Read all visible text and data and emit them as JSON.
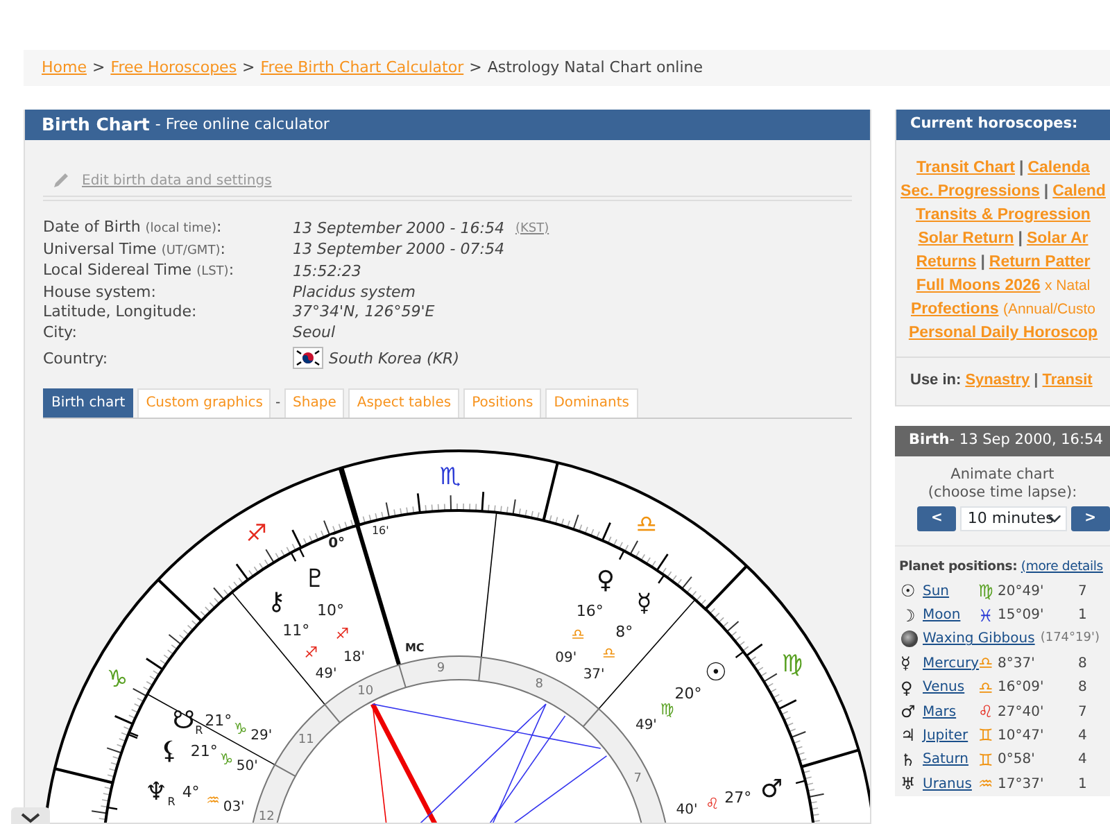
{
  "breadcrumb": [
    {
      "text": "Home",
      "kind": "link"
    },
    {
      "text": ">",
      "kind": "separator"
    },
    {
      "text": "Free Horoscopes",
      "kind": "link"
    },
    {
      "text": ">",
      "kind": "separator"
    },
    {
      "text": "Free Birth Chart Calculator",
      "kind": "link"
    },
    {
      "text": ">",
      "kind": "separator"
    },
    {
      "text": "Astrology Natal Chart online",
      "kind": "current"
    }
  ],
  "panel": {
    "title": "Birth Chart",
    "subtitle": "- Free online calculator",
    "edit_link": "Edit birth data and settings",
    "details": [
      {
        "label": "Date of Birth",
        "note": "(local time)",
        "suffix": ":",
        "value": "13 September 2000 - 16:54",
        "extra": "(KST)"
      },
      {
        "label": "Universal Time",
        "note": "(UT/GMT)",
        "suffix": ":",
        "value": "13 September 2000 - 07:54"
      },
      {
        "label": "Local Sidereal Time",
        "note": "(LST)",
        "suffix": ":",
        "value": "15:52:23"
      },
      {
        "label": "House system:",
        "value": "Placidus system"
      },
      {
        "label": "Latitude, Longitude:",
        "value": "37°34'N, 126°59'E"
      },
      {
        "label": "City:",
        "value": "Seoul"
      },
      {
        "label": "Country:",
        "value": "South Korea (KR)",
        "flag": true
      }
    ],
    "tabs": [
      {
        "label": "Birth chart",
        "selected": true
      },
      {
        "label": "Custom graphics",
        "selected": false,
        "separator_after": "-"
      },
      {
        "label": "Shape",
        "selected": false
      },
      {
        "label": "Aspect tables",
        "selected": false
      },
      {
        "label": "Positions",
        "selected": false
      },
      {
        "label": "Dominants",
        "selected": false
      }
    ],
    "chart": {
      "signs": [
        {
          "glyph": "♍"
        },
        {
          "glyph": "♎"
        },
        {
          "glyph": "♏"
        },
        {
          "glyph": "♐"
        },
        {
          "glyph": "♑"
        }
      ],
      "midheaven": {
        "label": "MC",
        "degree": "0°",
        "minute": "16'"
      },
      "houses": [
        "7",
        "8",
        "9",
        "10",
        "11",
        "12"
      ],
      "planets": [
        {
          "glyph": "☉",
          "degree": "20°",
          "sign": "♍",
          "minute": "49'"
        },
        {
          "glyph": "☿",
          "degree": "8°",
          "sign": "♎",
          "minute": "37'"
        },
        {
          "glyph": "♀",
          "degree": "16°",
          "sign": "♎",
          "minute": "09'"
        },
        {
          "glyph": "♂",
          "degree": "27°",
          "sign": "♌",
          "minute": "40'"
        },
        {
          "glyph": "♇",
          "degree": "10°",
          "sign": "♐",
          "minute": "18'"
        },
        {
          "glyph": "⚷",
          "degree": "11°",
          "sign": "♐",
          "minute": "49'"
        },
        {
          "glyph": "☋",
          "suffix": "R",
          "degree": "21°",
          "sign": "♑",
          "minute": "29'"
        },
        {
          "glyph": "⚸",
          "degree": "21°",
          "sign": "♑",
          "minute": "50'"
        },
        {
          "glyph": "♆",
          "suffix": "R",
          "degree": "4°",
          "sign": "♒",
          "minute": "03'"
        }
      ]
    }
  },
  "sidebar": {
    "current": {
      "title": "Current horoscopes:",
      "lines": [
        [
          {
            "text": "Transit Chart",
            "kind": "link"
          },
          {
            "text": "|",
            "kind": "separator"
          },
          {
            "text": "Calenda",
            "kind": "link"
          }
        ],
        [
          {
            "text": "Sec. Progressions",
            "kind": "link"
          },
          {
            "text": "|",
            "kind": "separator"
          },
          {
            "text": "Calend",
            "kind": "link"
          }
        ],
        [
          {
            "text": "Transits & Progression",
            "kind": "link"
          }
        ],
        [
          {
            "text": "Solar Return",
            "kind": "link"
          },
          {
            "text": "|",
            "kind": "separator"
          },
          {
            "text": "Solar Ar",
            "kind": "link"
          }
        ],
        [
          {
            "text": "Returns",
            "kind": "link"
          },
          {
            "text": "|",
            "kind": "separator"
          },
          {
            "text": "Return Patter",
            "kind": "link"
          }
        ],
        [
          {
            "text": "Full Moons 2026",
            "kind": "link"
          },
          {
            "text": "x Natal",
            "kind": "note"
          }
        ],
        [
          {
            "text": "Profections",
            "kind": "link"
          },
          {
            "text": "(Annual/Custo",
            "kind": "note"
          }
        ],
        [
          {
            "text": "Personal Daily Horoscop",
            "kind": "link"
          }
        ]
      ],
      "use_in": {
        "label": "Use in:",
        "links": [
          {
            "text": "Synastry",
            "kind": "link"
          },
          {
            "text": "|",
            "kind": "separator"
          },
          {
            "text": "Transit",
            "kind": "link"
          }
        ]
      }
    },
    "birth": {
      "title": "Birth",
      "subtitle": "- 13 Sep 2000, 16:54",
      "animate": "Animate chart",
      "animate_hint": "(choose time lapse):",
      "prev": "<",
      "lapse": "10 minutes",
      "next": ">",
      "positions_title": "Planet positions:",
      "positions_link": "(more details",
      "rows": [
        {
          "kind": "planet",
          "glyph": "☉",
          "name": "Sun",
          "sign": "♍",
          "position": "20°49'",
          "house": "7"
        },
        {
          "kind": "planet",
          "glyph": "☽",
          "name": "Moon",
          "sign": "♓",
          "position": "15°09'",
          "house": "1"
        },
        {
          "kind": "phase",
          "name": "Waxing Gibbous",
          "note": "(174°19')"
        },
        {
          "kind": "planet",
          "glyph": "☿",
          "name": "Mercury",
          "sign": "♎",
          "position": "8°37'",
          "house": "8"
        },
        {
          "kind": "planet",
          "glyph": "♀",
          "name": "Venus",
          "sign": "♎",
          "position": "16°09'",
          "house": "8"
        },
        {
          "kind": "planet",
          "glyph": "♂",
          "name": "Mars",
          "sign": "♌",
          "position": "27°40'",
          "house": "7"
        },
        {
          "kind": "planet",
          "glyph": "♃",
          "name": "Jupiter",
          "sign": "♊",
          "position": "10°47'",
          "house": "4"
        },
        {
          "kind": "planet",
          "glyph": "♄",
          "name": "Saturn",
          "sign": "♊",
          "position": "0°58'",
          "house": "4"
        },
        {
          "kind": "planet",
          "glyph": "♅",
          "name": "Uranus",
          "sign": "♒",
          "position": "17°37'",
          "house": "1"
        }
      ]
    }
  }
}
